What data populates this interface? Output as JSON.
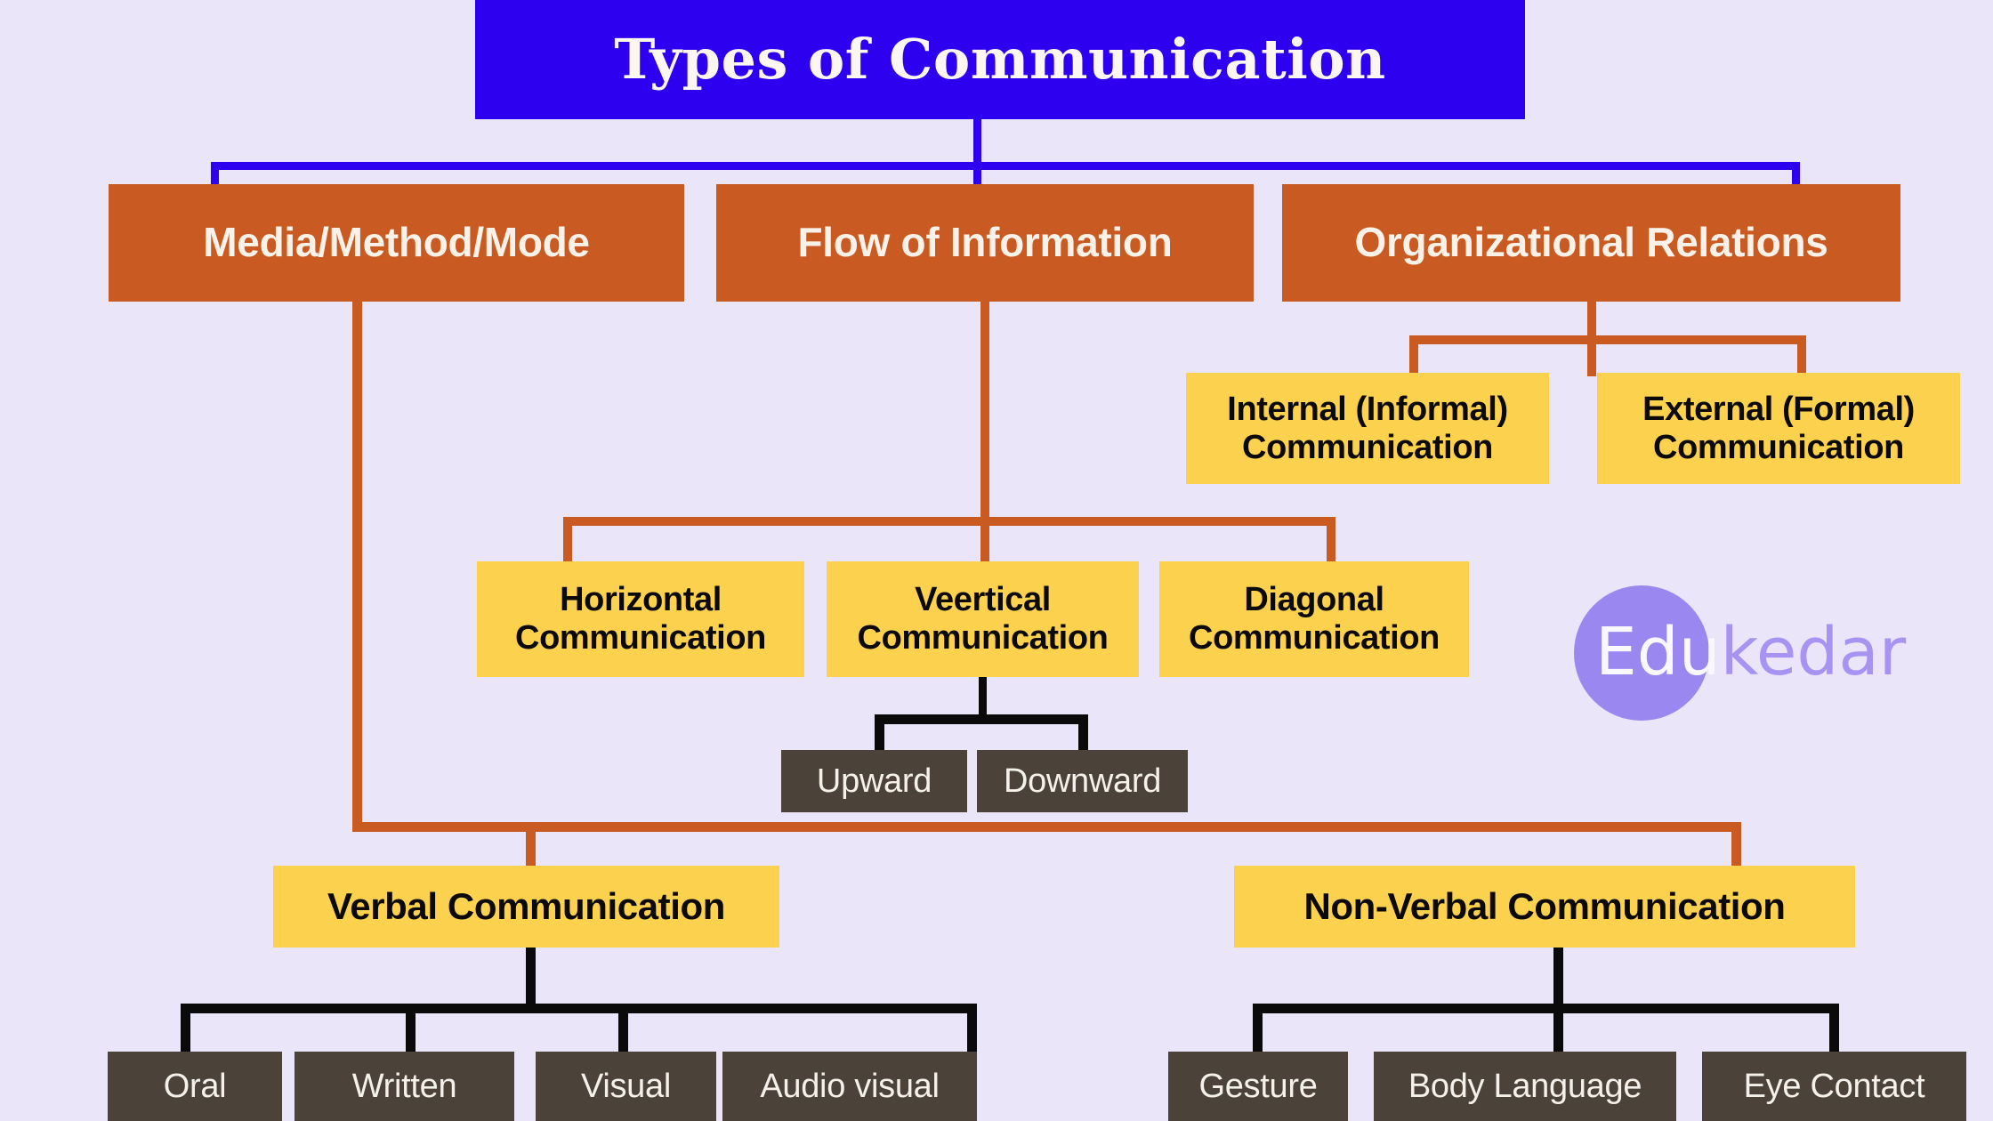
{
  "page": {
    "background_color": "#EBE5FA",
    "title_text": "Types of Communication"
  },
  "colors": {
    "title_box": "#2E00F0",
    "title_connector": "#2E00F0",
    "level2_box": "#C95A21",
    "level2_connector": "#C95A21",
    "level3_box": "#FCD14E",
    "leaf_box": "#4B4339",
    "leaf_connector": "#0A0A0A",
    "logo_circle": "#9B87F0",
    "logo_accent": "#A794F2"
  },
  "root": {
    "label": "Types of Communication"
  },
  "branches": [
    {
      "id": "media",
      "label": "Media/Method/Mode"
    },
    {
      "id": "flow",
      "label": "Flow of Information"
    },
    {
      "id": "org",
      "label": "Organizational Relations"
    }
  ],
  "org_children": [
    {
      "label_line1": "Internal (Informal)",
      "label_line2": "Communication"
    },
    {
      "label_line1": "External (Formal)",
      "label_line2": "Communication"
    }
  ],
  "flow_children": [
    {
      "label_line1": "Horizontal",
      "label_line2": "Communication"
    },
    {
      "label_line1": "Veertical",
      "label_line2": "Communication"
    },
    {
      "label_line1": "Diagonal",
      "label_line2": "Communication"
    }
  ],
  "vertical_children": [
    {
      "label": "Upward"
    },
    {
      "label": "Downward"
    }
  ],
  "media_children": [
    {
      "id": "verbal",
      "label": "Verbal Communication"
    },
    {
      "id": "nonverbal",
      "label": "Non-Verbal Communication"
    }
  ],
  "verbal_children": [
    {
      "label": "Oral"
    },
    {
      "label": "Written"
    },
    {
      "label": "Visual"
    },
    {
      "label": "Audio visual"
    }
  ],
  "nonverbal_children": [
    {
      "label": "Gesture"
    },
    {
      "label": "Body Language"
    },
    {
      "label": "Eye Contact"
    }
  ],
  "logo": {
    "primary": "Edu",
    "secondary": "kedar"
  }
}
